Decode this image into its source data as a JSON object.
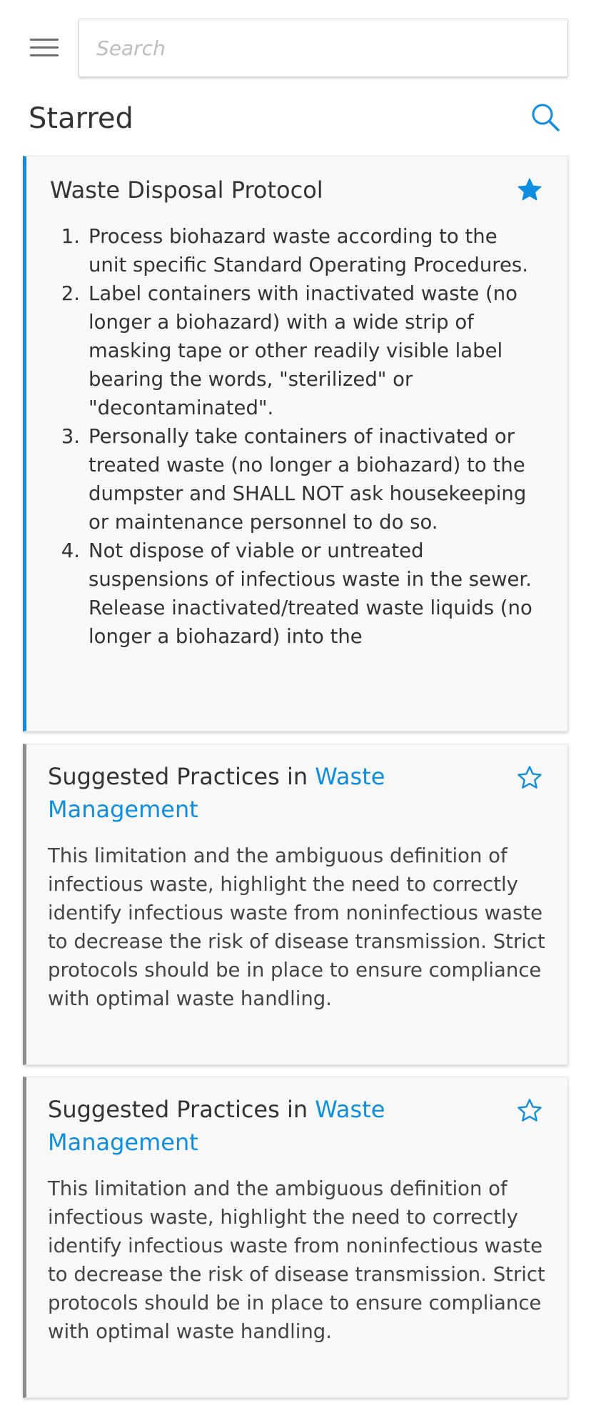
{
  "search": {
    "placeholder": "Search"
  },
  "page": {
    "title": "Starred"
  },
  "protocol_card": {
    "title": "Waste Disposal Protocol",
    "starred": true,
    "steps": [
      {
        "num": "1.",
        "text": "Process biohazard waste according to the unit specific Standard Operating Procedures."
      },
      {
        "num": "2.",
        "text": "Label containers with inactivated waste (no longer a biohazard) with a wide strip of masking tape or other readily visible label bearing the words, \"sterilized\" or \"decontaminated\"."
      },
      {
        "num": "3.",
        "text": "Personally take containers of inactivated or treated waste (no longer a biohazard) to the dumpster and SHALL NOT ask housekeeping or maintenance personnel to do so."
      },
      {
        "num": "4.",
        "text": "Not dispose of viable or untreated suspensions of infectious waste in the sewer. Release inactivated/treated waste liquids (no longer a biohazard) into the"
      }
    ]
  },
  "suggested_cards": [
    {
      "label": "Suggested Practices",
      "connector": "in",
      "link": "Waste Management",
      "starred": false,
      "body": "This limitation and the ambiguous definition of infectious waste, highlight the need to correctly identify infectious waste from noninfectious waste to decrease the risk of disease transmission. Strict protocols should be in place to ensure compliance with optimal waste handling."
    },
    {
      "label": "Suggested Practices",
      "connector": "in",
      "link": "Waste Management",
      "starred": false,
      "body": "This limitation and the ambiguous definition of infectious waste, highlight the need to correctly identify infectious waste from noninfectious waste to decrease the risk of disease transmission. Strict protocols should be in place to ensure compliance with optimal waste handling."
    }
  ],
  "colors": {
    "accent": "#0d8ee0",
    "text": "#333333",
    "card_bg": "#f8f8f8",
    "card_border_neutral": "#8d8d8d"
  },
  "icons": {
    "menu": "hamburger-menu-icon",
    "search": "search-icon",
    "star_filled": "star-filled-icon",
    "star_outline": "star-outline-icon"
  }
}
